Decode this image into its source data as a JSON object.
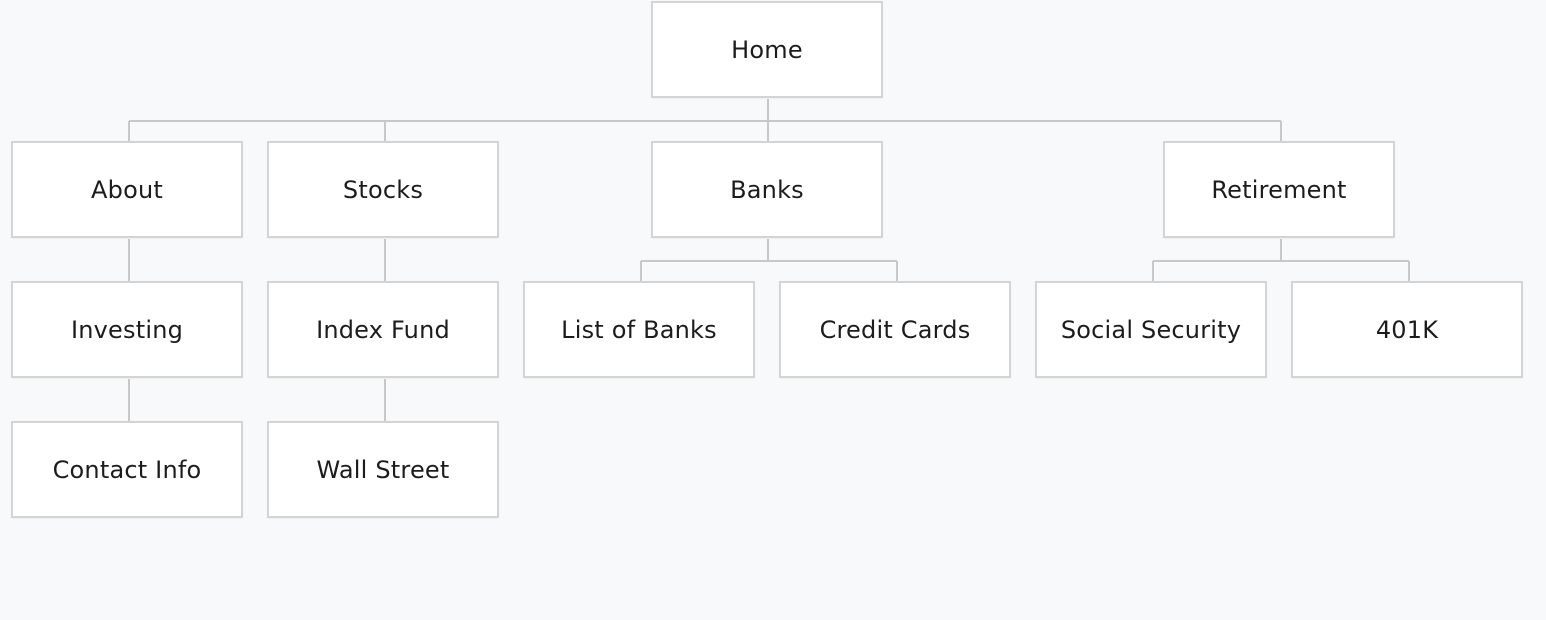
{
  "sitemap": {
    "home": "Home",
    "about": "About",
    "stocks": "Stocks",
    "banks": "Banks",
    "retirement": "Retirement",
    "investing": "Investing",
    "index_fund": "Index Fund",
    "list_of_banks": "List of Banks",
    "credit_cards": "Credit Cards",
    "social_security": "Social Security",
    "k401": "401K",
    "contact_info": "Contact Info",
    "wall_street": "Wall Street"
  },
  "colors": {
    "background": "#f8f9fa",
    "node_fill": "#ffffff",
    "node_border": "#d4d4d4",
    "connector": "#c8c8c8",
    "text": "#1c1c1c"
  }
}
